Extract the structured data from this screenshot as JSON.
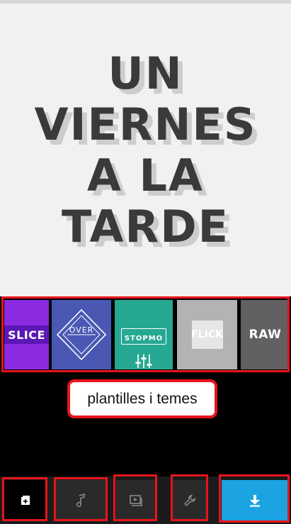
{
  "preview": {
    "title_lines": [
      "UN",
      "VIERNES",
      "A LA",
      "TARDE"
    ]
  },
  "themes": {
    "items": [
      {
        "label": "SLICE",
        "color": "#8a2be2"
      },
      {
        "label": "OVER",
        "color": "#4a58b4"
      },
      {
        "label": "STOPMO",
        "color": "#27a892"
      },
      {
        "label": "FLICK",
        "color": "#b3b3b3"
      },
      {
        "label": "RAW",
        "color": "#616161"
      }
    ]
  },
  "tooltip": {
    "text": "plantilles i temes"
  },
  "toolbar": {
    "buttons": [
      {
        "icon": "add-media-icon"
      },
      {
        "icon": "music-note-icon"
      },
      {
        "icon": "play-clip-icon"
      },
      {
        "icon": "wrench-icon"
      },
      {
        "icon": "download-icon",
        "color": "#1ba3e2"
      }
    ]
  }
}
